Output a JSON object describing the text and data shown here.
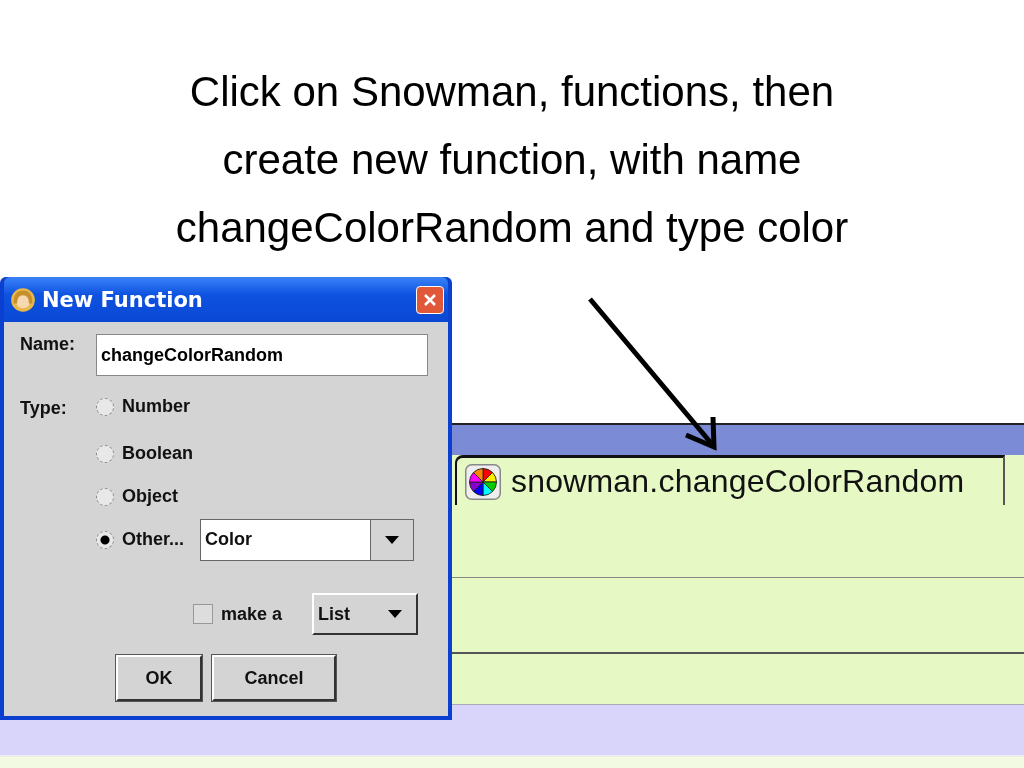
{
  "slide": {
    "title": "Click on Snowman, functions, then create new function, with name changeColorRandom and type color"
  },
  "editor": {
    "tab": {
      "label": "snowman.changeColorRandom"
    }
  },
  "dialog": {
    "title": "New Function",
    "name_label": "Name:",
    "name_value": "changeColorRandom",
    "type_label": "Type:",
    "type_options": [
      {
        "label": "Number",
        "selected": false
      },
      {
        "label": "Boolean",
        "selected": false
      },
      {
        "label": "Object",
        "selected": false
      },
      {
        "label": "Other...",
        "selected": true
      }
    ],
    "other_type": "Color",
    "make_list": {
      "label": "make a",
      "checked": false
    },
    "list_option": "List",
    "buttons": [
      "OK",
      "Cancel"
    ]
  }
}
